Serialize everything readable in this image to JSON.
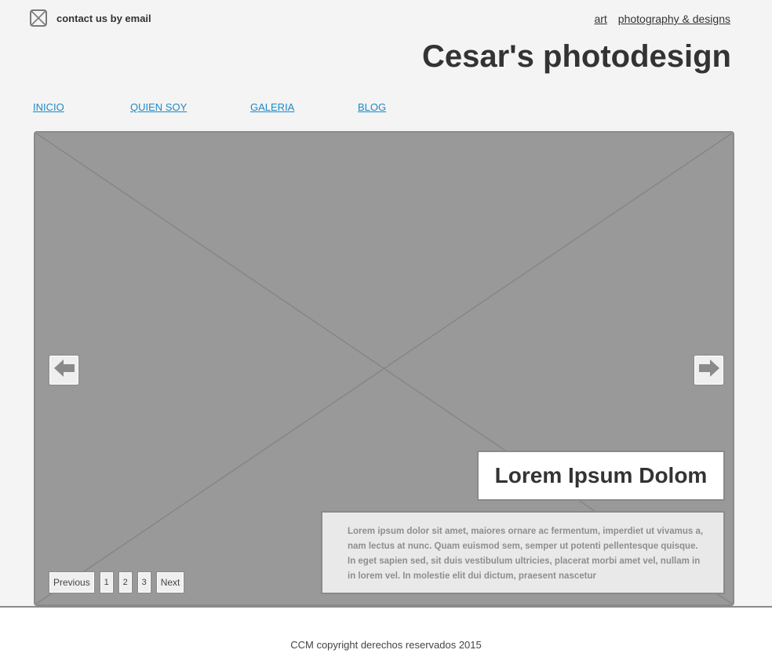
{
  "header": {
    "contact_label": "contact us by email",
    "contact_icon": "email-icon",
    "top_links": [
      "art",
      "photography & designs"
    ],
    "site_title": "Cesar's photodesign"
  },
  "nav": {
    "items": [
      "INICIO",
      "QUIEN SOY",
      "GALERIA",
      "BLOG"
    ],
    "link_color": "#1a8ac8"
  },
  "slider": {
    "image_placeholder": "image-placeholder",
    "prev_icon": "arrow-left-icon",
    "next_icon": "arrow-right-icon",
    "caption_title": "Lorem Ipsum Dolom",
    "caption_text": "Lorem ipsum dolor sit amet, maiores ornare ac fermentum, imperdiet ut vivamus a, nam lectus at nunc. Quam euismod sem, semper ut potenti pellentesque quisque. In eget sapien sed, sit duis vestibulum ultricies, placerat morbi amet vel, nullam in in lorem vel. In molestie elit dui dictum, praesent nascetur",
    "pager": {
      "previous": "Previous",
      "pages": [
        "1",
        "2",
        "3"
      ],
      "next": "Next"
    }
  },
  "footer": {
    "copyright": "CCM copyright derechos reservados 2015"
  }
}
